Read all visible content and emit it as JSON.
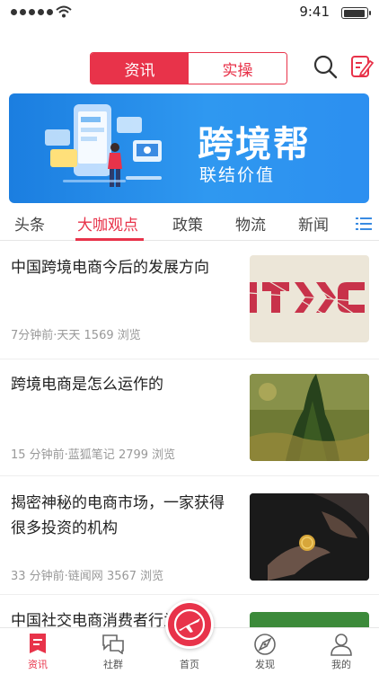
{
  "status_bar": {
    "time": "9:41"
  },
  "segment": {
    "tabs": [
      {
        "label": "资讯"
      },
      {
        "label": "实操"
      }
    ]
  },
  "banner": {
    "title": "跨境帮",
    "subtitle": "联结价值"
  },
  "categories": [
    {
      "label": "头条"
    },
    {
      "label": "大咖观点"
    },
    {
      "label": "政策"
    },
    {
      "label": "物流"
    },
    {
      "label": "新闻"
    }
  ],
  "articles": [
    {
      "title": "中国跨境电商今后的发展方向",
      "meta": "7分钟前·天天   1569 浏览",
      "thumb_icon": "jtxc-logo-image"
    },
    {
      "title": "跨境电商是怎么运作的",
      "meta": "15 分钟前·蓝狐笔记   2799 浏览",
      "thumb_icon": "cypress-painting-image"
    },
    {
      "title": "揭密神秘的电商市场，一家获得很多投资的机构",
      "meta": "33 分钟前·链闻网   3567 浏览",
      "thumb_icon": "coin-in-hand-image"
    },
    {
      "title": "中国社交电商消费者行为分析",
      "meta": "",
      "thumb_icon": "green-image"
    }
  ],
  "tabbar": {
    "items": [
      {
        "label": "资讯",
        "icon": "news-icon"
      },
      {
        "label": "社群",
        "icon": "chat-icon"
      },
      {
        "label": "首页",
        "icon": "home-plane-icon"
      },
      {
        "label": "发现",
        "icon": "discover-icon"
      },
      {
        "label": "我的",
        "icon": "profile-icon"
      }
    ]
  },
  "colors": {
    "accent": "#e8334a",
    "banner_blue": "#1b7ee0"
  }
}
